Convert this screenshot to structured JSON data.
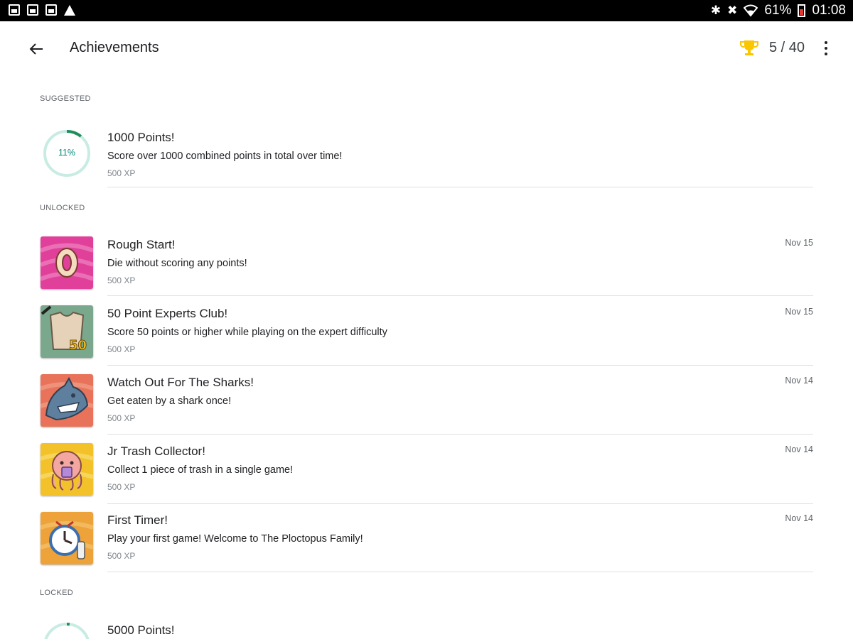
{
  "header": {
    "title": "Achievements",
    "score": "5 / 40",
    "trophy_color": "#f9c600"
  },
  "statusbar": {
    "battery": "61%",
    "time": "01:08",
    "left_icons": [
      "gallery-icon",
      "photo-icon",
      "image-icon",
      "warning-icon"
    ],
    "right_icons": [
      "bluetooth-icon",
      "mute-icon",
      "wifi-icon",
      "battery-icon"
    ]
  },
  "sections": {
    "suggested": "SUGGESTED",
    "unlocked": "UNLOCKED",
    "locked": "LOCKED"
  },
  "suggested": [
    {
      "title": "1000 Points!",
      "desc": "Score over 1000 combined points in total over time!",
      "xp": "500 XP",
      "progress_label": "11%",
      "progress": 0.11
    }
  ],
  "unlocked": [
    {
      "title": "Rough Start!",
      "desc": "Die without scoring any points!",
      "xp": "500 XP",
      "date": "Nov 15",
      "icon": "zero-badge-icon",
      "bg": "#e0409a"
    },
    {
      "title": "50 Point Experts Club!",
      "desc": "Score 50 points or higher while playing on the expert difficulty",
      "xp": "500 XP",
      "date": "Nov 15",
      "icon": "fifty-badge-icon",
      "bg": "#7aa88c"
    },
    {
      "title": "Watch Out For The Sharks!",
      "desc": "Get eaten by a shark once!",
      "xp": "500 XP",
      "date": "Nov 14",
      "icon": "shark-icon",
      "bg": "#e8735a"
    },
    {
      "title": "Jr Trash Collector!",
      "desc": "Collect 1 piece of trash in a single game!",
      "xp": "500 XP",
      "date": "Nov 14",
      "icon": "octopus-icon",
      "bg": "#f3c22b"
    },
    {
      "title": "First Timer!",
      "desc": "Play your first game! Welcome to The Ploctopus Family!",
      "xp": "500 XP",
      "date": "Nov 14",
      "icon": "clock-icon",
      "bg": "#eda33a"
    }
  ],
  "locked": [
    {
      "title": "5000 Points!",
      "progress": 0.02
    }
  ],
  "colors": {
    "progress": "#1f8f5a",
    "progress_track": "#c8ece3"
  }
}
